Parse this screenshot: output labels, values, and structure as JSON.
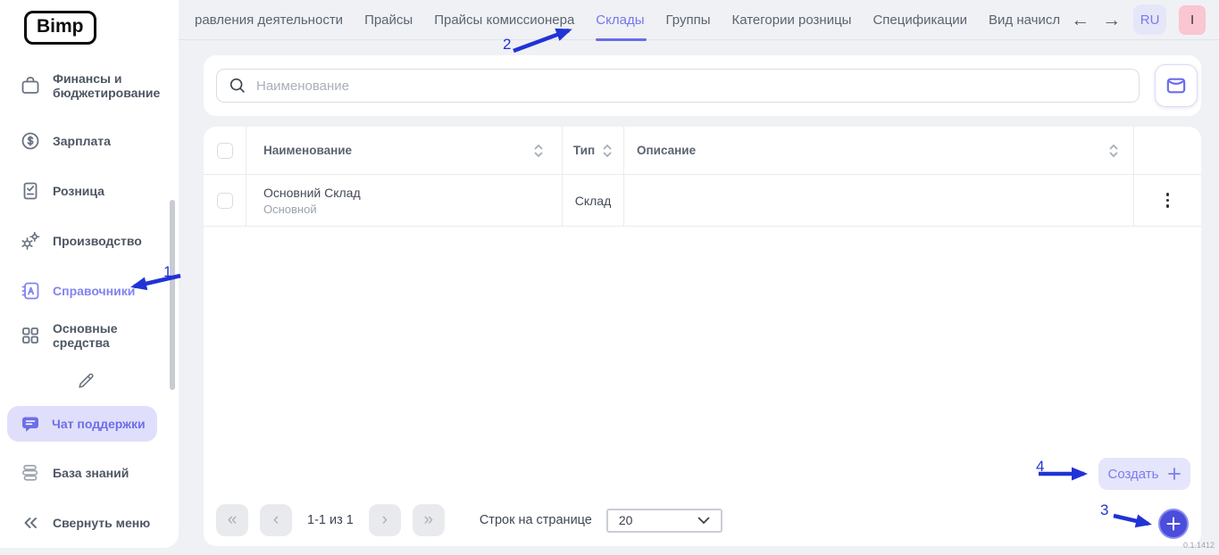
{
  "app": {
    "logo": "Bimp",
    "version": "0.1.1412"
  },
  "colors": {
    "accent": "#7577EA",
    "accent_dark": "#4B4DDB",
    "annotation_blue": "#2133D6",
    "avatar_bg": "#F9C6D2",
    "pill_bg": "#DFDFFB",
    "page_bg": "#EFF1F5"
  },
  "sidebar": {
    "items": [
      {
        "label": "Финансы и бюджетирование",
        "icon": "briefcase-icon"
      },
      {
        "label": "Зарплата",
        "icon": "dollar-circle-icon"
      },
      {
        "label": "Розница",
        "icon": "clipboard-check-icon"
      },
      {
        "label": "Производство",
        "icon": "gears-icon"
      },
      {
        "label": "Справочники",
        "icon": "dictionary-icon",
        "active": true
      },
      {
        "label": "Основные средства",
        "icon": "grid-icon"
      }
    ],
    "support_chat": "Чат поддержки",
    "knowledge_base": "База знаний",
    "collapse": "Свернуть меню"
  },
  "topbar": {
    "tabs": [
      "равления деятельности",
      "Прайсы",
      "Прайсы комиссионера",
      "Склады",
      "Группы",
      "Категории розницы",
      "Спецификации",
      "Вид начисл"
    ],
    "active_tab": "Склады",
    "back_arrow": "←",
    "forward_arrow": "→",
    "lang": "RU",
    "avatar": "I"
  },
  "search": {
    "placeholder": "Наименование"
  },
  "table": {
    "columns": [
      "Наименование",
      "Тип",
      "Описание"
    ],
    "rows": [
      {
        "name": "Основний Склад",
        "subtitle": "Основной",
        "type": "Склад",
        "description": ""
      }
    ]
  },
  "pagination": {
    "first": "«",
    "prev": "‹",
    "next": "›",
    "last": "»",
    "range": "1-1 из 1",
    "rows_per_page_label": "Строк на странице",
    "rows_per_page": "20"
  },
  "actions": {
    "create": "Создать"
  },
  "annotations": {
    "labels": [
      "1",
      "2",
      "3",
      "4"
    ]
  }
}
